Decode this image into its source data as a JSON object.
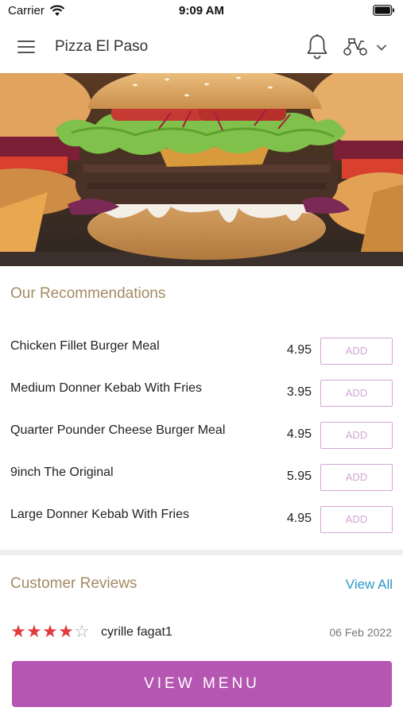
{
  "status_bar": {
    "carrier": "Carrier",
    "time": "9:09 AM"
  },
  "header": {
    "title": "Pizza El Paso",
    "icons": [
      "menu-icon",
      "bell-icon",
      "scooter-icon",
      "chevron-down-icon"
    ]
  },
  "hero": {
    "image": "burger-photo"
  },
  "recommendations": {
    "title": "Our Recommendations",
    "items": [
      {
        "name": "Chicken Fillet Burger Meal",
        "price": "4.95",
        "action": "ADD"
      },
      {
        "name": "Medium Donner Kebab With Fries",
        "price": "3.95",
        "action": "ADD"
      },
      {
        "name": "Quarter Pounder Cheese Burger Meal",
        "price": "4.95",
        "action": "ADD"
      },
      {
        "name": "9inch The Original",
        "price": "5.95",
        "action": "ADD"
      },
      {
        "name": "Large Donner Kebab With Fries",
        "price": "4.95",
        "action": "ADD"
      }
    ]
  },
  "reviews": {
    "title": "Customer Reviews",
    "view_all": "View All",
    "items": [
      {
        "rating": 4,
        "max_rating": 5,
        "reviewer": "cyrille fagat1",
        "date": "06 Feb 2022"
      }
    ]
  },
  "footer": {
    "button_label": "VIEW MENU"
  },
  "colors": {
    "accent": "#b556b2",
    "section_title": "#a38b64",
    "link": "#2c97c9",
    "star": "#e13a3a",
    "add_border": "#d7a5d8"
  }
}
